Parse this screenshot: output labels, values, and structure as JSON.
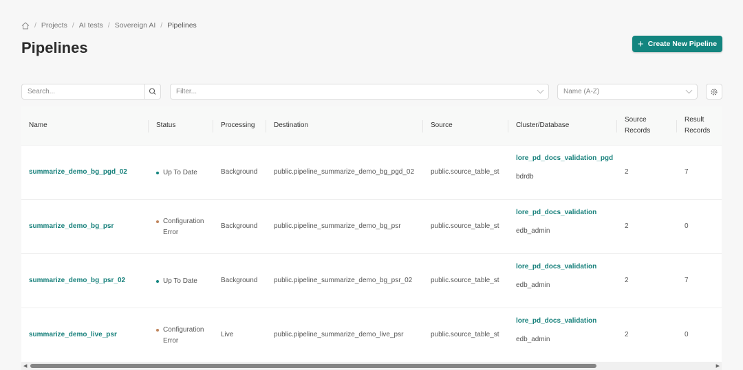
{
  "breadcrumb": {
    "items": [
      "Projects",
      "AI tests",
      "Sovereign AI"
    ],
    "current": "Pipelines"
  },
  "page": {
    "title": "Pipelines",
    "create_label": "Create New Pipeline"
  },
  "toolbar": {
    "search_placeholder": "Search...",
    "filter_placeholder": "Filter...",
    "sort_value": "Name (A-Z)"
  },
  "table": {
    "columns": [
      "Name",
      "Status",
      "Processing",
      "Destination",
      "Source",
      "Cluster/Database",
      "Source Records",
      "Result Records"
    ],
    "rows": [
      {
        "name": "summarize_demo_bg_pgd_02",
        "status": "Up To Date",
        "processing": "Background",
        "destination": "public.pipeline_summarize_demo_bg_pgd_02",
        "source": "public.source_table_st",
        "cluster": "lore_pd_docs_validation_pgd",
        "database": "bdrdb",
        "source_records": "2",
        "result_records": "7"
      },
      {
        "name": "summarize_demo_bg_psr",
        "status": "Configuration Error",
        "processing": "Background",
        "destination": "public.pipeline_summarize_demo_bg_psr",
        "source": "public.source_table_st",
        "cluster": "lore_pd_docs_validation",
        "database": "edb_admin",
        "source_records": "2",
        "result_records": "0"
      },
      {
        "name": "summarize_demo_bg_psr_02",
        "status": "Up To Date",
        "processing": "Background",
        "destination": "public.pipeline_summarize_demo_bg_psr_02",
        "source": "public.source_table_st",
        "cluster": "lore_pd_docs_validation",
        "database": "edb_admin",
        "source_records": "2",
        "result_records": "7"
      },
      {
        "name": "summarize_demo_live_psr",
        "status": "Configuration Error",
        "processing": "Live",
        "destination": "public.pipeline_summarize_demo_live_psr",
        "source": "public.source_table_st",
        "cluster": "lore_pd_docs_validation",
        "database": "edb_admin",
        "source_records": "2",
        "result_records": "0"
      }
    ]
  },
  "colors": {
    "accent": "#13857f",
    "status_ok": "#13857f",
    "status_error": "#c0855c"
  }
}
